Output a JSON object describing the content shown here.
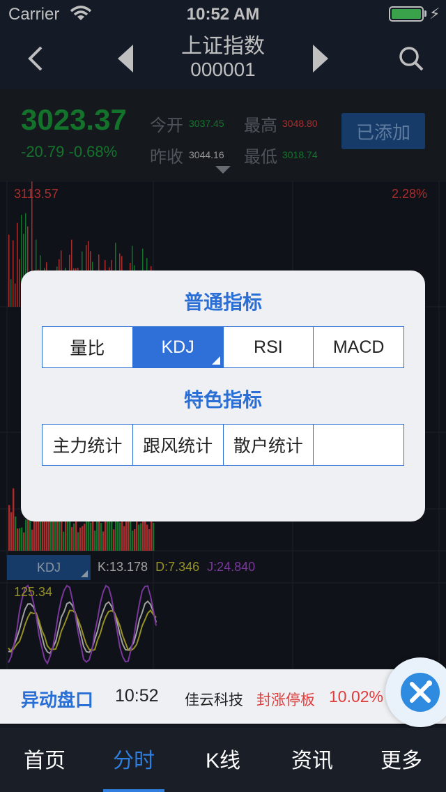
{
  "status": {
    "carrier": "Carrier",
    "time": "10:52 AM"
  },
  "header": {
    "name": "上证指数",
    "code": "000001"
  },
  "quote": {
    "price": "3023.37",
    "change": "-20.79 -0.68%",
    "open_label": "今开",
    "open": "3037.45",
    "high_label": "最高",
    "high": "3048.80",
    "prev_label": "昨收",
    "prev": "3044.16",
    "low_label": "最低",
    "low": "3018.74",
    "add_button": "已添加"
  },
  "chart": {
    "price_max": "3113.57",
    "pct_max": "2.28%",
    "volume_axis": "125.34",
    "indicator_button": "KDJ",
    "k": "K:13.178",
    "d": "D:7.346",
    "j": "J:24.840"
  },
  "modal": {
    "section1_title": "普通指标",
    "section1_items": [
      "量比",
      "KDJ",
      "RSI",
      "MACD"
    ],
    "section1_active": 1,
    "section2_title": "特色指标",
    "section2_items": [
      "主力统计",
      "跟风统计",
      "散户统计",
      ""
    ]
  },
  "ticker": {
    "label": "异动盘口",
    "time": "10:52",
    "stock": "佳云科技",
    "event": "封涨停板",
    "pct": "10.02%"
  },
  "tabs": [
    "首页",
    "分时",
    "K线",
    "资讯",
    "更多"
  ],
  "active_tab": 1,
  "colors": {
    "up": "#e03c3c",
    "down": "#1a9a3a",
    "accent": "#2f6fd8",
    "k": "#d8d8d8",
    "d": "#c8c230",
    "j": "#a24ad0"
  }
}
